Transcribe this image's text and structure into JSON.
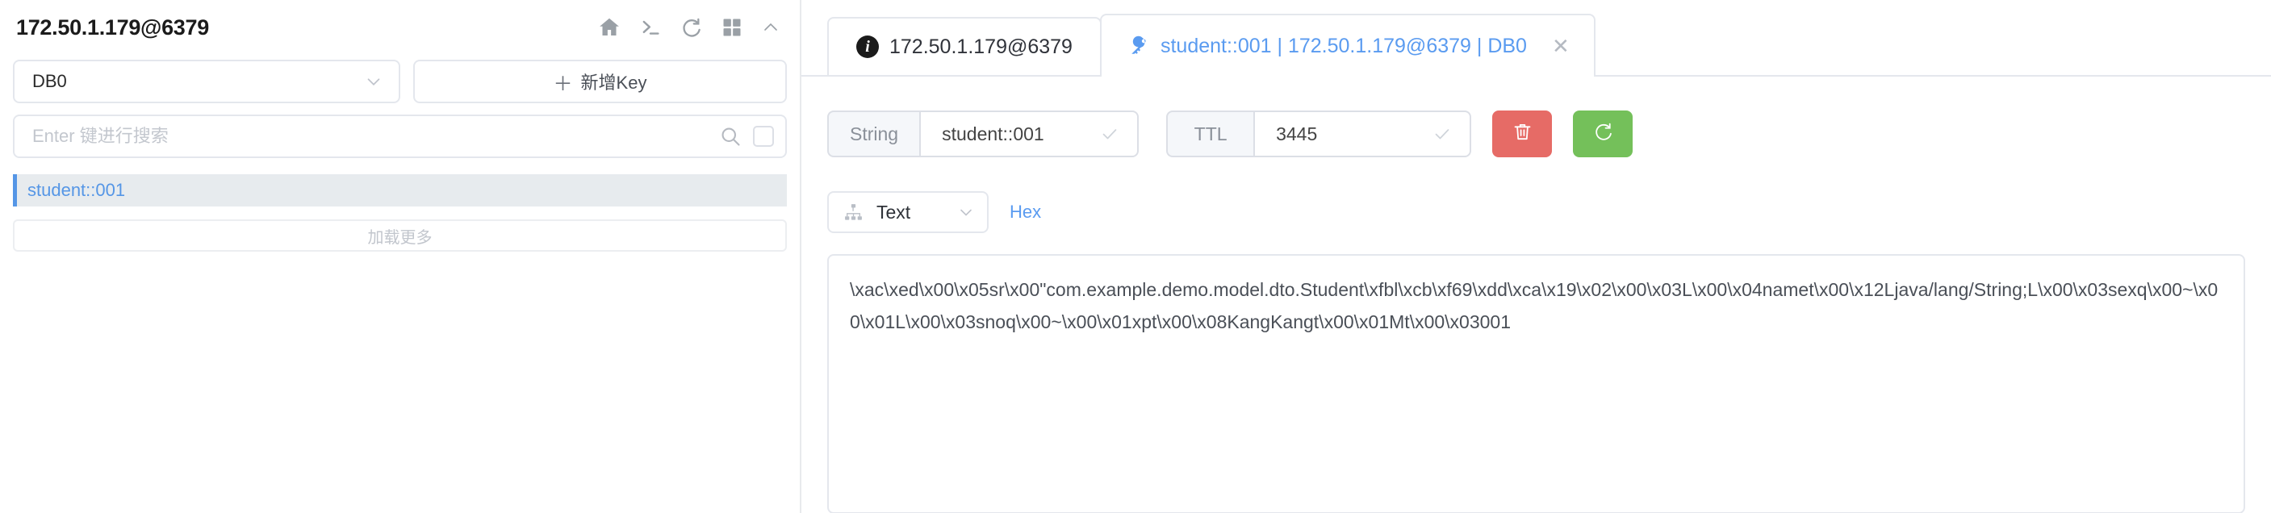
{
  "sidebar": {
    "title": "172.50.1.179@6379",
    "header_icons": [
      {
        "name": "home-icon"
      },
      {
        "name": "terminal-icon"
      },
      {
        "name": "refresh-icon"
      },
      {
        "name": "grid-icon"
      },
      {
        "name": "chevron-up-icon"
      }
    ],
    "db_select": {
      "value": "DB0",
      "chevron": "chevron-down-icon"
    },
    "add_key_button": {
      "plus": "＋",
      "label": "新增Key"
    },
    "search": {
      "value": "",
      "placeholder": "Enter 键进行搜索",
      "icon": "search-icon",
      "checkbox": "select-all-checkbox"
    },
    "keys": [
      {
        "name": "student::001",
        "selected": true
      }
    ],
    "load_more_label": "加载更多"
  },
  "main": {
    "tabs": [
      {
        "id": "server-info",
        "icon": "info-icon",
        "label": "172.50.1.179@6379",
        "active": false,
        "closable": false
      },
      {
        "id": "key-detail",
        "icon": "key-icon",
        "label": "student::001 | 172.50.1.179@6379 | DB0",
        "active": true,
        "closable": true,
        "close_glyph": "✕"
      }
    ],
    "key_form": {
      "type_label": "String",
      "key_value": "student::001",
      "key_check_icon": "check-icon",
      "ttl_label": "TTL",
      "ttl_value": "3445",
      "ttl_check_icon": "check-icon",
      "delete_button": {
        "name": "delete-key-button",
        "icon": "trash-icon"
      },
      "refresh_button": {
        "name": "refresh-key-button",
        "icon": "refresh-icon"
      }
    },
    "view_bar": {
      "format_icon": "sitemap-icon",
      "format_value": "Text",
      "format_chevron": "chevron-down-icon",
      "hex_link": "Hex"
    },
    "value_content": "\\xac\\xed\\x00\\x05sr\\x00\"com.example.demo.model.dto.Student\\xfbl\\xcb\\xf69\\xdd\\xca\\x19\\x02\\x00\\x03L\\x00\\x04namet\\x00\\x12Ljava/lang/String;L\\x00\\x03sexq\\x00~\\x00\\x01L\\x00\\x03snoq\\x00~\\x00\\x01xpt\\x00\\x08KangKangt\\x00\\x01Mt\\x00\\x03001"
  },
  "colors": {
    "accent_blue": "#5596e6",
    "danger_red": "#e66b66",
    "success_green": "#74c05a",
    "border_gray": "#e4e7ed",
    "selected_bg": "#e7ebee"
  }
}
